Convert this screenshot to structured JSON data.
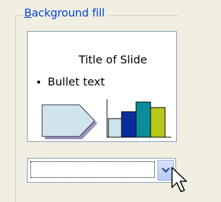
{
  "group": {
    "title_mnemonic": "B",
    "title_rest": "ackground fill"
  },
  "preview": {
    "slide_title": "Title of Slide",
    "bullet_text": "Bullet text",
    "colors": {
      "arrow_fill": "#cfe4ec",
      "arrow_shadow": "#9c8fbf",
      "bar1": "#cce5ec",
      "bar2": "#0b2c9b",
      "bar3": "#0a8c9a",
      "bar4": "#b9c61a"
    }
  },
  "combo": {
    "value": "",
    "button_icon": "chevron-down-icon"
  },
  "cursor_icon": "mouse-pointer-icon"
}
